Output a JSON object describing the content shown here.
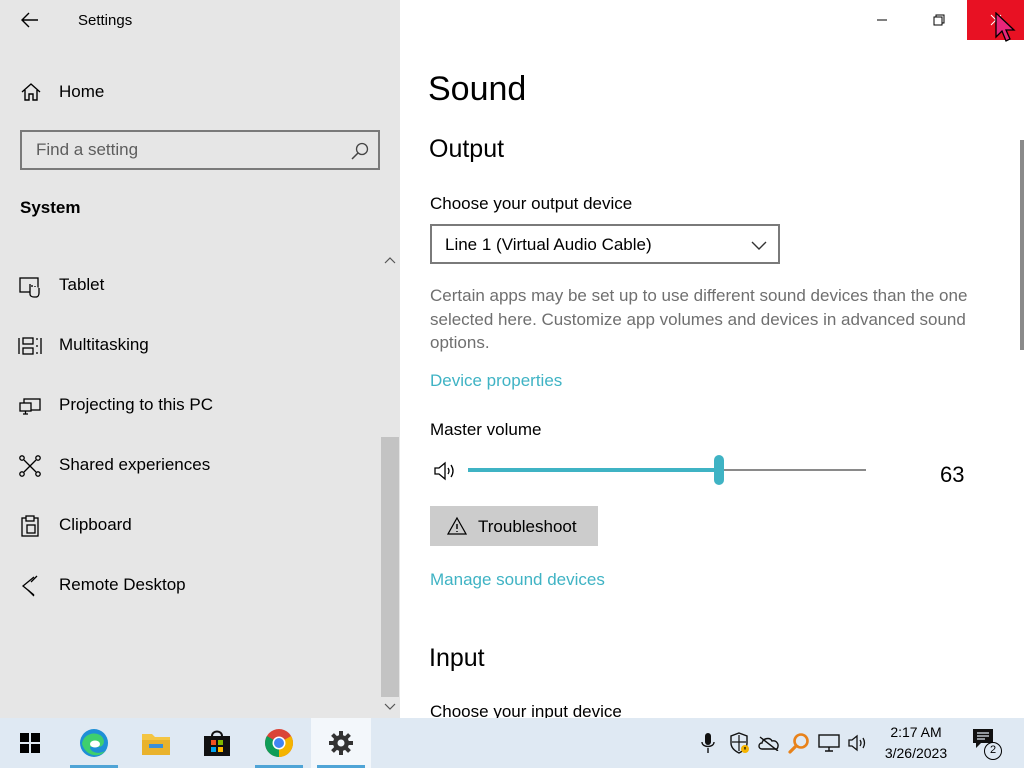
{
  "window": {
    "app_title": "Settings"
  },
  "nav": {
    "home_label": "Home",
    "search_placeholder": "Find a setting",
    "section_heading": "System",
    "items": [
      {
        "label": "Tablet",
        "icon": "tablet-icon"
      },
      {
        "label": "Multitasking",
        "icon": "multitasking-icon"
      },
      {
        "label": "Projecting to this PC",
        "icon": "projecting-icon"
      },
      {
        "label": "Shared experiences",
        "icon": "shared-experiences-icon"
      },
      {
        "label": "Clipboard",
        "icon": "clipboard-icon"
      },
      {
        "label": "Remote Desktop",
        "icon": "remote-desktop-icon"
      }
    ]
  },
  "content": {
    "page_title": "Sound",
    "output": {
      "heading": "Output",
      "device_label": "Choose your output device",
      "device_value": "Line 1 (Virtual Audio Cable)",
      "description": "Certain apps may be set up to use different sound devices than the one selected here. Customize app volumes and devices in advanced sound options.",
      "device_properties_link": "Device properties",
      "master_volume_label": "Master volume",
      "master_volume_value": "63",
      "master_volume_level": 63,
      "troubleshoot_label": "Troubleshoot",
      "manage_devices_link": "Manage sound devices"
    },
    "input": {
      "heading": "Input",
      "device_label": "Choose your input device"
    }
  },
  "taskbar": {
    "apps": [
      "edge-icon",
      "file-explorer-icon",
      "microsoft-store-icon",
      "chrome-icon",
      "settings-icon"
    ],
    "tray": [
      "microphone-icon",
      "security-icon",
      "onedrive-icon",
      "search-magnifier-icon",
      "network-icon",
      "volume-icon"
    ],
    "time": "2:17 AM",
    "date": "3/26/2023",
    "notification_count": "2"
  },
  "colors": {
    "accent": "#3fb3c4",
    "close_hover": "#e81123",
    "nav_background": "#e6e6e6",
    "taskbar_background": "#dfe9f3"
  }
}
